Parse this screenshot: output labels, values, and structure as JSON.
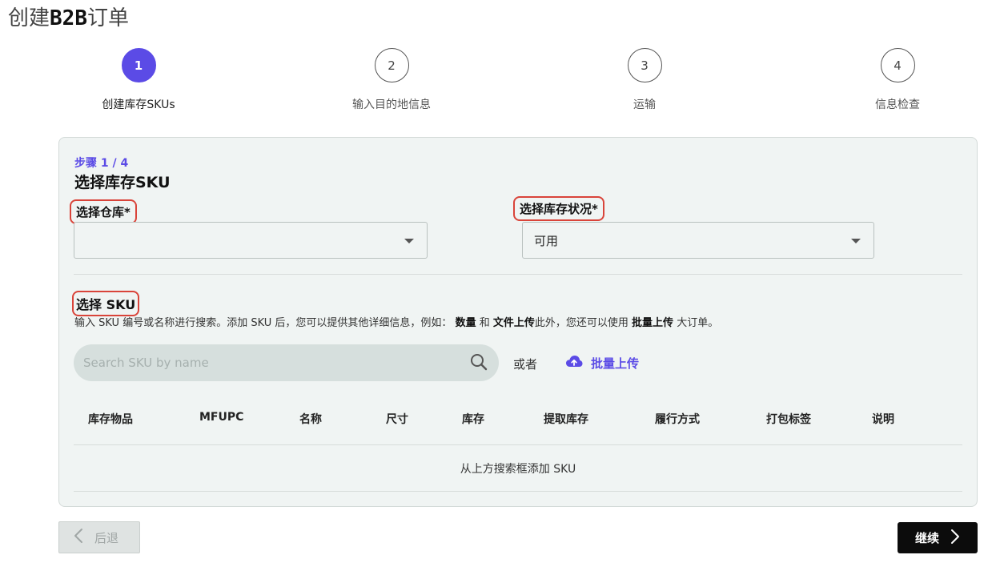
{
  "page": {
    "title_prefix": "创建",
    "title_brand": "B2B",
    "title_suffix": "订单"
  },
  "stepper": {
    "steps": [
      {
        "number": "1",
        "label": "创建库存SKUs",
        "active": true
      },
      {
        "number": "2",
        "label": "输入目的地信息",
        "active": false
      },
      {
        "number": "3",
        "label": "运输",
        "active": false
      },
      {
        "number": "4",
        "label": "信息检查",
        "active": false
      }
    ]
  },
  "form": {
    "step_indicator": "步骤 1 / 4",
    "heading": "选择库存SKU",
    "warehouse": {
      "label": "选择仓库*",
      "value": ""
    },
    "inventory_status": {
      "label": "选择库存状况*",
      "value": "可用"
    },
    "sku_section": {
      "title": "选择 SKU",
      "desc_part1": "输入 SKU 编号或名称进行搜索。添加 SKU 后，您可以提供其他详细信息，例如：",
      "desc_bold1": "数量",
      "desc_and": "和",
      "desc_bold2": "文件上传",
      "desc_part2": "此外，您还可以使用",
      "desc_bold3": "批量上传",
      "desc_part3": "大订单。"
    },
    "search": {
      "placeholder": "Search SKU by name",
      "value": ""
    },
    "or_text": "或者",
    "bulk_upload_label": "批量上传",
    "table": {
      "columns": [
        "库存物品",
        "MFUPC",
        "名称",
        "尺寸",
        "库存",
        "提取库存",
        "履行方式",
        "打包标签",
        "说明"
      ],
      "empty_message": "从上方搜索框添加 SKU"
    }
  },
  "nav": {
    "back_label": "后退",
    "continue_label": "继续"
  },
  "colors": {
    "accent": "#5b4be6",
    "highlight_outline": "#d9443a",
    "card_background": "#f0f4f3",
    "primary_button": "#0c0c0c"
  }
}
